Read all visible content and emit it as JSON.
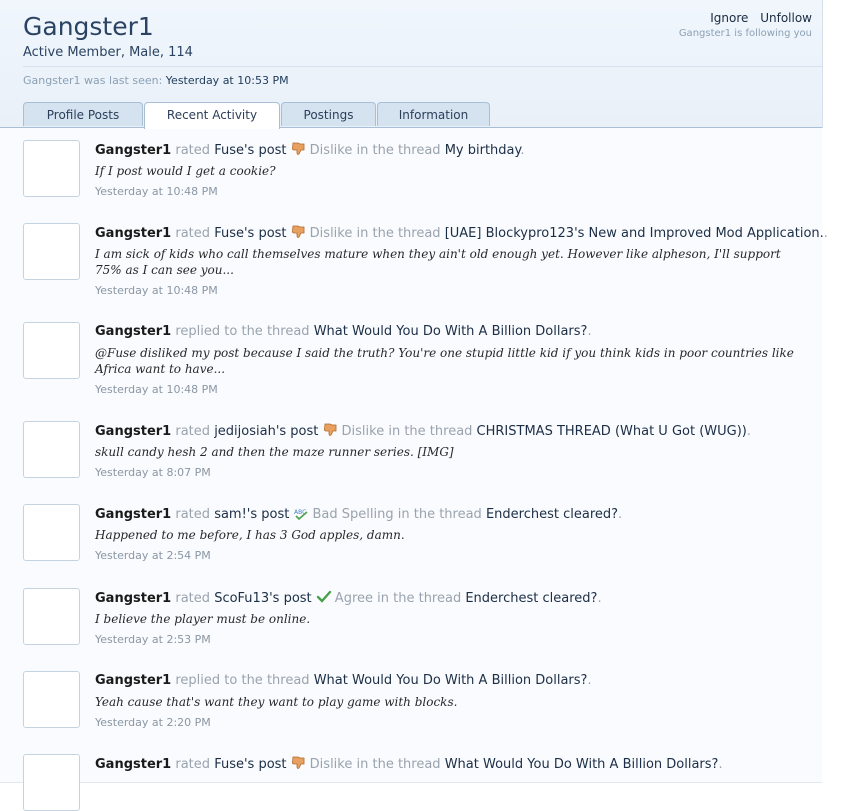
{
  "profile": {
    "username": "Gangster1",
    "user_title": "Active Member, Male, 114",
    "ignore_label": "Ignore",
    "unfollow_label": "Unfollow",
    "following_text": "Gangster1 is following you",
    "last_seen_label": "Gangster1 was last seen:",
    "last_seen_value": "Yesterday at 10:53 PM"
  },
  "tabs": [
    {
      "label": "Profile Posts"
    },
    {
      "label": "Recent Activity",
      "active": true
    },
    {
      "label": "Postings"
    },
    {
      "label": "Information"
    }
  ],
  "feed": [
    {
      "user": "Gangster1",
      "action": "rated",
      "target": "Fuse's post",
      "icon": "dislike-icon",
      "rating": "Dislike",
      "thread_prefix": "in the thread",
      "thread": "My birthday",
      "snippet": "If I post would I get a cookie?",
      "time": "Yesterday at 10:48 PM"
    },
    {
      "user": "Gangster1",
      "action": "rated",
      "target": "Fuse's post",
      "icon": "dislike-icon",
      "rating": "Dislike",
      "thread_prefix": "in the thread",
      "thread": "[UAE] Blockypro123's New and Improved Mod Application.",
      "snippet": "I am sick of kids who call themselves mature when they ain't old enough yet. However like alpheson, I'll support 75% as I can see you...",
      "time": "Yesterday at 10:48 PM"
    },
    {
      "user": "Gangster1",
      "action": "replied to the thread",
      "target": "",
      "icon": "",
      "rating": "",
      "thread_prefix": "",
      "thread": "What Would You Do With A Billion Dollars?",
      "snippet": "@Fuse disliked my post because I said the truth? You're one stupid little kid if you think kids in poor countries like Africa want to have...",
      "time": "Yesterday at 10:48 PM"
    },
    {
      "user": "Gangster1",
      "action": "rated",
      "target": "jedijosiah's post",
      "icon": "dislike-icon",
      "rating": "Dislike",
      "thread_prefix": "in the thread",
      "thread": "CHRISTMAS THREAD (What U Got (WUG))",
      "snippet": "skull candy hesh 2 and then the maze runner series. [IMG]",
      "time": "Yesterday at 8:07 PM"
    },
    {
      "user": "Gangster1",
      "action": "rated",
      "target": "sam!'s post",
      "icon": "spelling-icon",
      "rating": "Bad Spelling",
      "thread_prefix": "in the thread",
      "thread": "Enderchest cleared?",
      "snippet": "Happened to me before, I has 3 God apples, damn.",
      "time": "Yesterday at 2:54 PM"
    },
    {
      "user": "Gangster1",
      "action": "rated",
      "target": "ScoFu13's post",
      "icon": "agree-icon",
      "rating": "Agree",
      "thread_prefix": "in the thread",
      "thread": "Enderchest cleared?",
      "snippet": "I believe the player must be online.",
      "time": "Yesterday at 2:53 PM"
    },
    {
      "user": "Gangster1",
      "action": "replied to the thread",
      "target": "",
      "icon": "",
      "rating": "",
      "thread_prefix": "",
      "thread": "What Would You Do With A Billion Dollars?",
      "snippet": "Yeah cause that's want they want to play game with blocks.",
      "time": "Yesterday at 2:20 PM"
    },
    {
      "user": "Gangster1",
      "action": "rated",
      "target": "Fuse's post",
      "icon": "dislike-icon",
      "rating": "Dislike",
      "thread_prefix": "in the thread",
      "thread": "What Would You Do With A Billion Dollars?",
      "snippet": "",
      "time": ""
    }
  ]
}
